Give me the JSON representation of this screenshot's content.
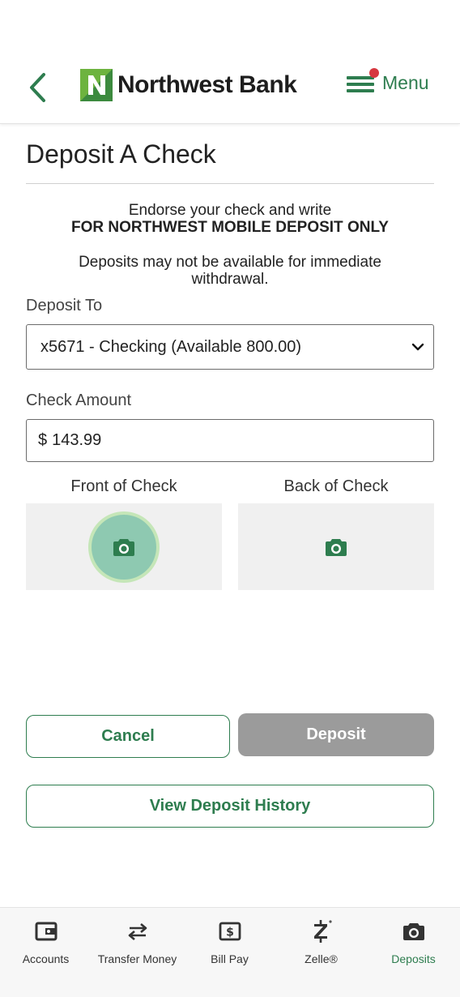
{
  "header": {
    "brand_name": "Northwest Bank",
    "menu_label": "Menu",
    "colors": {
      "brand_green": "#2e7d4f",
      "notification_dot": "#d6373f"
    }
  },
  "page": {
    "title": "Deposit A Check",
    "instruction_line1": "Endorse your check and write",
    "instruction_line2": "FOR NORTHWEST MOBILE DEPOSIT ONLY",
    "availability_line1": "Deposits may not be available for immediate",
    "availability_line2": "withdrawal."
  },
  "form": {
    "deposit_to_label": "Deposit To",
    "deposit_to_selected": "x5671 - Checking (Available 800.00)",
    "check_amount_label": "Check Amount",
    "currency_symbol": "$",
    "check_amount_value": "143.99",
    "front_label": "Front of Check",
    "back_label": "Back of Check"
  },
  "actions": {
    "cancel_label": "Cancel",
    "deposit_label": "Deposit",
    "history_label": "View Deposit History"
  },
  "tabbar": {
    "items": [
      {
        "label": "Accounts",
        "icon": "wallet-icon"
      },
      {
        "label": "Transfer Money",
        "icon": "transfer-arrows-icon"
      },
      {
        "label": "Bill Pay",
        "icon": "dollar-bill-icon"
      },
      {
        "label": "Zelle®",
        "icon": "zelle-icon"
      },
      {
        "label": "Deposits",
        "icon": "camera-icon",
        "active": true
      }
    ]
  }
}
